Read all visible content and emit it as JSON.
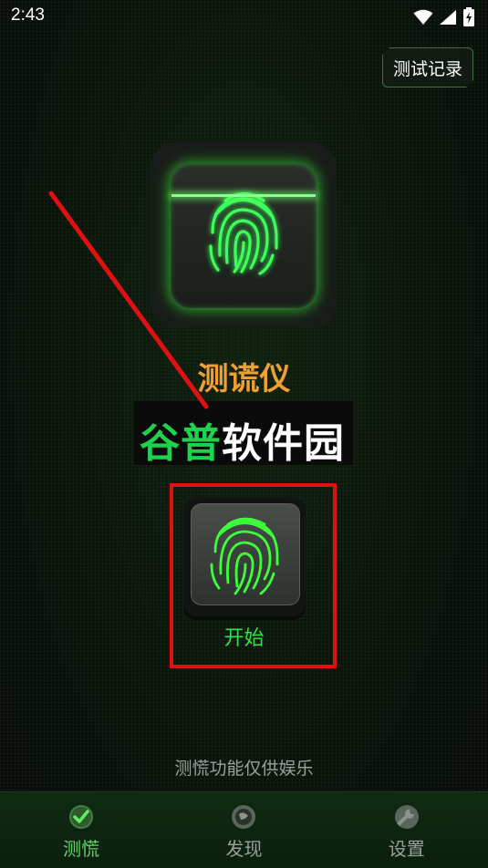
{
  "status_bar": {
    "time": "2:43"
  },
  "header": {
    "record_label": "测试记录"
  },
  "app": {
    "title": "测谎仪"
  },
  "watermark": {
    "part1": "谷普",
    "part2": "软件园"
  },
  "start_button": {
    "label": "开始"
  },
  "disclaimer": "测慌功能仅供娱乐",
  "bottom_nav": {
    "items": [
      {
        "label": "测慌",
        "icon": "check-circle-icon",
        "active": true
      },
      {
        "label": "发现",
        "icon": "discover-icon",
        "active": false
      },
      {
        "label": "设置",
        "icon": "wrench-icon",
        "active": false
      }
    ]
  },
  "colors": {
    "accent_green": "#32e04a",
    "title_orange": "#f0a030",
    "annotation_red": "#e01010"
  }
}
